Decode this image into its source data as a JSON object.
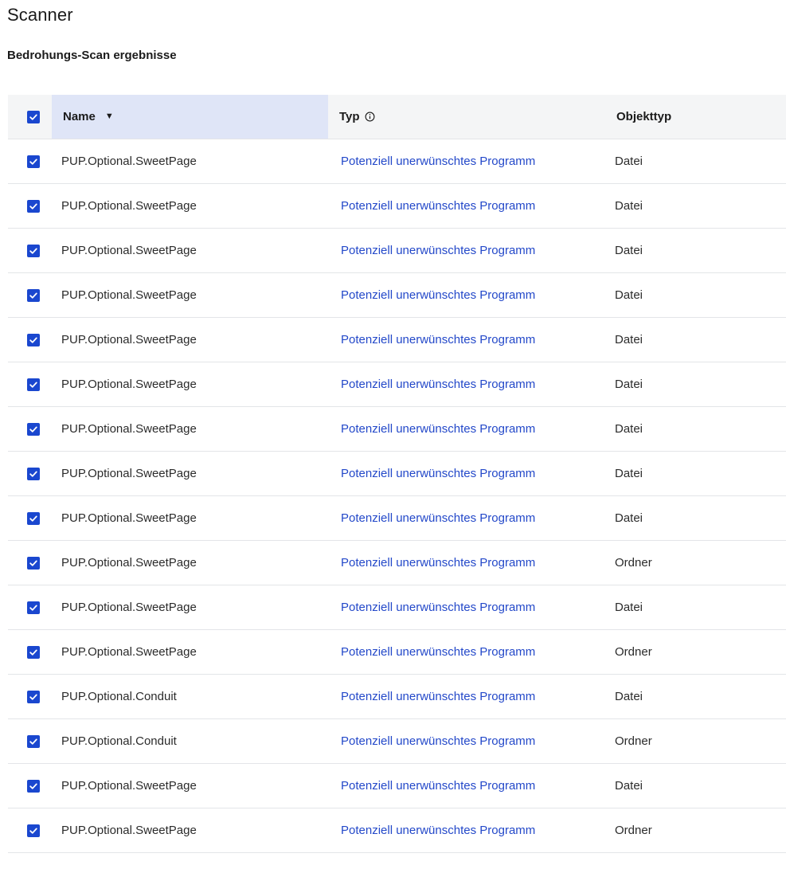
{
  "page": {
    "title": "Scanner",
    "subtitle": "Bedrohungs-Scan ergebnisse"
  },
  "table": {
    "columns": {
      "name": "Name",
      "typ": "Typ",
      "objekttyp": "Objekttyp"
    },
    "sort_column": "name",
    "sort_direction": "descending",
    "select_all_checked": true,
    "rows": [
      {
        "checked": true,
        "name": "PUP.Optional.SweetPage",
        "typ": "Potenziell unerwünschtes Programm",
        "objekttyp": "Datei"
      },
      {
        "checked": true,
        "name": "PUP.Optional.SweetPage",
        "typ": "Potenziell unerwünschtes Programm",
        "objekttyp": "Datei"
      },
      {
        "checked": true,
        "name": "PUP.Optional.SweetPage",
        "typ": "Potenziell unerwünschtes Programm",
        "objekttyp": "Datei"
      },
      {
        "checked": true,
        "name": "PUP.Optional.SweetPage",
        "typ": "Potenziell unerwünschtes Programm",
        "objekttyp": "Datei"
      },
      {
        "checked": true,
        "name": "PUP.Optional.SweetPage",
        "typ": "Potenziell unerwünschtes Programm",
        "objekttyp": "Datei"
      },
      {
        "checked": true,
        "name": "PUP.Optional.SweetPage",
        "typ": "Potenziell unerwünschtes Programm",
        "objekttyp": "Datei"
      },
      {
        "checked": true,
        "name": "PUP.Optional.SweetPage",
        "typ": "Potenziell unerwünschtes Programm",
        "objekttyp": "Datei"
      },
      {
        "checked": true,
        "name": "PUP.Optional.SweetPage",
        "typ": "Potenziell unerwünschtes Programm",
        "objekttyp": "Datei"
      },
      {
        "checked": true,
        "name": "PUP.Optional.SweetPage",
        "typ": "Potenziell unerwünschtes Programm",
        "objekttyp": "Datei"
      },
      {
        "checked": true,
        "name": "PUP.Optional.SweetPage",
        "typ": "Potenziell unerwünschtes Programm",
        "objekttyp": "Ordner"
      },
      {
        "checked": true,
        "name": "PUP.Optional.SweetPage",
        "typ": "Potenziell unerwünschtes Programm",
        "objekttyp": "Datei"
      },
      {
        "checked": true,
        "name": "PUP.Optional.SweetPage",
        "typ": "Potenziell unerwünschtes Programm",
        "objekttyp": "Ordner"
      },
      {
        "checked": true,
        "name": "PUP.Optional.Conduit",
        "typ": "Potenziell unerwünschtes Programm",
        "objekttyp": "Datei"
      },
      {
        "checked": true,
        "name": "PUP.Optional.Conduit",
        "typ": "Potenziell unerwünschtes Programm",
        "objekttyp": "Ordner"
      },
      {
        "checked": true,
        "name": "PUP.Optional.SweetPage",
        "typ": "Potenziell unerwünschtes Programm",
        "objekttyp": "Datei"
      },
      {
        "checked": true,
        "name": "PUP.Optional.SweetPage",
        "typ": "Potenziell unerwünschtes Programm",
        "objekttyp": "Ordner"
      }
    ]
  },
  "icons": {
    "sort": "sort-descending-icon",
    "info": "info-icon",
    "checkbox": "checkbox-checked-icon"
  },
  "colors": {
    "accent": "#1a47cf",
    "link": "#2348c9",
    "header_bg": "#f4f5f6",
    "sorted_header_bg": "#dfe5f7",
    "divider": "#e3e5e8"
  }
}
